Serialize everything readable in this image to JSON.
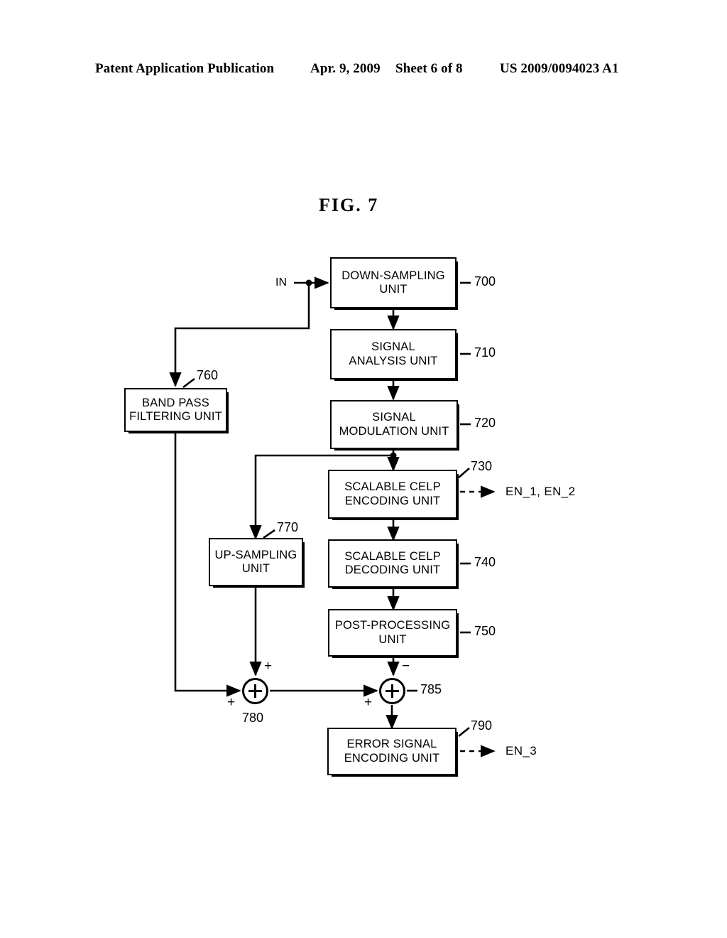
{
  "header": {
    "publication": "Patent Application Publication",
    "date": "Apr. 9, 2009",
    "sheet": "Sheet 6 of 8",
    "patent_number": "US 2009/0094023 A1"
  },
  "figure": {
    "title": "FIG.  7",
    "type": "block-diagram",
    "input_label": "IN",
    "nodes": [
      {
        "id": "700",
        "label": "DOWN-SAMPLING\nUNIT",
        "ref": "700"
      },
      {
        "id": "710",
        "label": "SIGNAL\nANALYSIS UNIT",
        "ref": "710"
      },
      {
        "id": "720",
        "label": "SIGNAL\nMODULATION UNIT",
        "ref": "720"
      },
      {
        "id": "730",
        "label": "SCALABLE CELP\nENCODING UNIT",
        "ref": "730"
      },
      {
        "id": "740",
        "label": "SCALABLE CELP\nDECODING UNIT",
        "ref": "740"
      },
      {
        "id": "750",
        "label": "POST-PROCESSING\nUNIT",
        "ref": "750"
      },
      {
        "id": "760",
        "label": "BAND PASS\nFILTERING UNIT",
        "ref": "760"
      },
      {
        "id": "770",
        "label": "UP-SAMPLING\nUNIT",
        "ref": "770"
      },
      {
        "id": "790",
        "label": "ERROR SIGNAL\nENCODING UNIT",
        "ref": "790"
      }
    ],
    "adders": [
      {
        "id": "780",
        "ref": "780",
        "top_sign": "+",
        "left_sign": "+"
      },
      {
        "id": "785",
        "ref": "785",
        "top_sign": "−",
        "left_sign": "+"
      }
    ],
    "outputs": [
      {
        "from": "730",
        "label": "EN_1, EN_2"
      },
      {
        "from": "790",
        "label": "EN_3"
      }
    ],
    "line_color": "#000000"
  }
}
